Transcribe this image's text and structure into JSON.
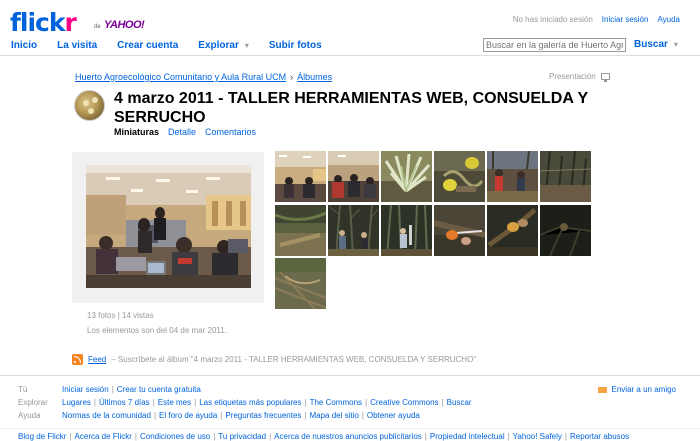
{
  "header": {
    "logo_text_blue": "flick",
    "logo_text_pink": "r",
    "logo_de": "de",
    "logo_yahoo": "YAHOO!",
    "not_signed_in": "No has iniciado sesión",
    "sign_in": "Iniciar sesión",
    "help": "Ayuda",
    "nav": [
      {
        "label": "Inicio"
      },
      {
        "label": "La visita"
      },
      {
        "label": "Crear cuenta"
      },
      {
        "label": "Explorar",
        "has_menu": true
      },
      {
        "label": "Subir fotos"
      }
    ],
    "search_placeholder": "Buscar en la galería de Huerto Agroecológico",
    "search_button": "Buscar"
  },
  "album": {
    "breadcrumb_owner": "Huerto Agroecológico Comunitario y Aula Rural UCM",
    "breadcrumb_sep": "›",
    "breadcrumb_albums": "Álbumes",
    "presentation": "Presentación",
    "title": "4 marzo 2011 - TALLER HERRAMIENTAS WEB, CONSUELDA Y SERRUCHO",
    "tabs": [
      {
        "label": "Miniaturas",
        "current": true
      },
      {
        "label": "Detalle",
        "current": false
      },
      {
        "label": "Comentarios",
        "current": false
      }
    ],
    "stats": "13 fotos | 14 vistas",
    "dates": "Los elementos son del 04 de mar 2011."
  },
  "thumbnails": [
    {
      "scene": "classroom"
    },
    {
      "scene": "classroom"
    },
    {
      "scene": "comfrey-plant"
    },
    {
      "scene": "hands-glove"
    },
    {
      "scene": "garden-people"
    },
    {
      "scene": "garden-bare"
    },
    {
      "scene": "grass-saw"
    },
    {
      "scene": "trees-people"
    },
    {
      "scene": "trees-people"
    },
    {
      "scene": "saw-cut"
    },
    {
      "scene": "hands-dark"
    },
    {
      "scene": "dark-branches"
    },
    {
      "scene": "garden-ground"
    }
  ],
  "feed": {
    "label": "Feed",
    "description": "– Suscríbete al álbum \"4 marzo 2011 - TALLER HERRAMIENTAS WEB, CONSUELDA Y SERRUCHO\""
  },
  "footer": {
    "rows": [
      {
        "label": "Tú",
        "items": [
          "Iniciar sesión",
          "Crear tu cuenta gratuita"
        ]
      },
      {
        "label": "Explorar",
        "items": [
          "Lugares",
          "Últimos 7 días",
          "Este mes",
          "Las etiquetas más populares",
          "The Commons",
          "Creative Commons",
          "Buscar"
        ]
      },
      {
        "label": "Ayuda",
        "items": [
          "Normas de la comunidad",
          "El foro de ayuda",
          "Preguntas frecuentes",
          "Mapa del sitio",
          "Obtener ayuda"
        ]
      }
    ],
    "send_friend": "Enviar a un amigo",
    "bottom_links": [
      "Blog de Flickr",
      "Acerca de Flickr",
      "Condiciones de uso",
      "Tu privacidad",
      "Acerca de nuestros anuncios publicitarios",
      "Propiedad intelectual",
      "Yahoo! Safely",
      "Reportar abusos"
    ]
  },
  "colors": {
    "link": "#0063dc",
    "flickr_pink": "#ff0084",
    "yahoo_purple": "#7b0099",
    "muted": "#999999"
  }
}
